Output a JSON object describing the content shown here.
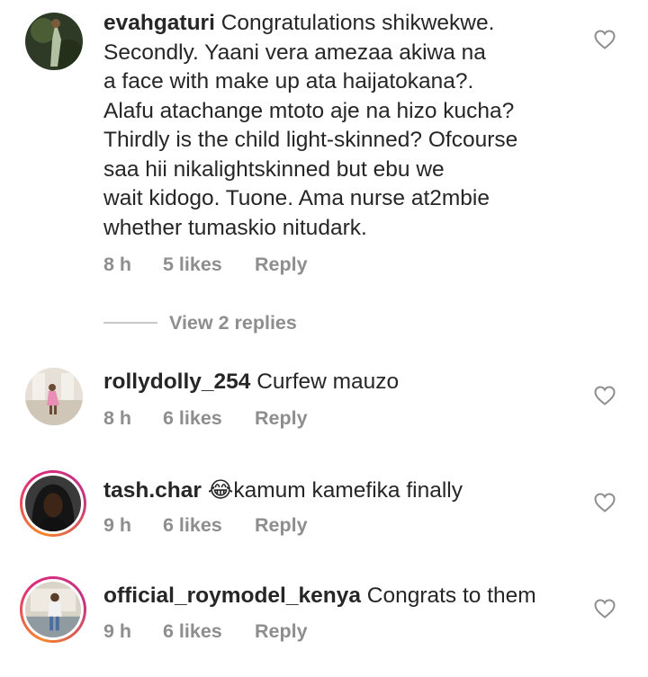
{
  "comments": [
    {
      "username": "evahgaturi",
      "text": "Congratulations shikwekwe.\nSecondly. Yaani vera amezaa akiwa na\na face with make up ata haijatokana?.\nAlafu atachange mtoto aje na hizo kucha?\nThirdly is the child light-skinned? Ofcourse\nsaa hii nikalightskinned but ebu we\nwait kidogo. Tuone. Ama nurse at2mbie\nwhether tumaskio nitudark.",
      "time": "8 h",
      "likes": "5 likes",
      "reply": "Reply"
    },
    {
      "username": "rollydolly_254",
      "text": "Curfew mauzo",
      "time": "8 h",
      "likes": "6 likes",
      "reply": "Reply"
    },
    {
      "username": "tash.char",
      "emoji": "😂",
      "text": "kamum kamefika finally",
      "time": "9 h",
      "likes": "6 likes",
      "reply": "Reply"
    },
    {
      "username": "official_roymodel_kenya",
      "text": "Congrats to them",
      "time": "9 h",
      "likes": "6 likes",
      "reply": "Reply"
    }
  ],
  "view_replies": "View 2 replies",
  "icons": {
    "like": "heart-outline-icon"
  },
  "colors": {
    "text": "#262626",
    "meta": "#8e8e8e",
    "ring_start": "#f58529",
    "ring_end": "#dd2a7b"
  }
}
